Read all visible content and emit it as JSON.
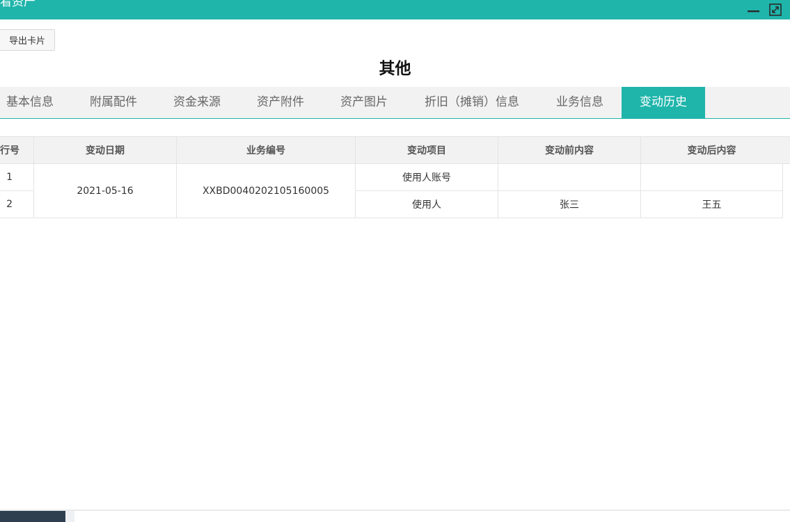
{
  "window": {
    "title": "看资产",
    "accent_color": "#1fb5ab",
    "minimize_icon": "minimize-icon",
    "maximize_icon": "maximize-icon"
  },
  "toolbar": {
    "export_label": "导出卡片"
  },
  "page": {
    "title": "其他"
  },
  "tabs": [
    {
      "label": "基本信息",
      "active": false
    },
    {
      "label": "附属配件",
      "active": false
    },
    {
      "label": "资金来源",
      "active": false
    },
    {
      "label": "资产附件",
      "active": false
    },
    {
      "label": "资产图片",
      "active": false
    },
    {
      "label": "折旧（摊销）信息",
      "active": false
    },
    {
      "label": "业务信息",
      "active": false
    },
    {
      "label": "变动历史",
      "active": true
    }
  ],
  "history_table": {
    "columns": [
      "行号",
      "变动日期",
      "业务编号",
      "变动项目",
      "变动前内容",
      "变动后内容"
    ],
    "rows": [
      {
        "row_no": "1",
        "date": "2021-05-16",
        "biz_no": "XXBD0040202105160005",
        "item": "使用人账号",
        "before": "",
        "after": ""
      },
      {
        "row_no": "2",
        "date": "",
        "biz_no": "",
        "item": "使用人",
        "before": "张三",
        "after": "王五"
      }
    ]
  }
}
